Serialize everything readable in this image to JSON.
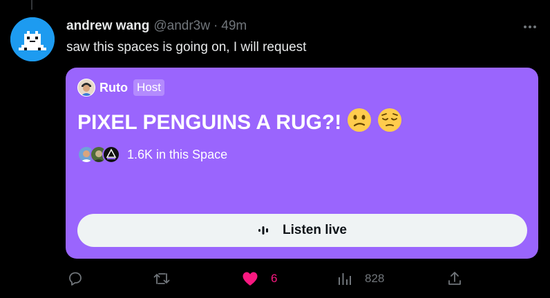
{
  "tweet": {
    "author_name": "andrew wang",
    "handle": "@andr3w",
    "separator": "·",
    "time": "49m",
    "text": "saw this spaces is going on, I will request"
  },
  "space": {
    "host_name": "Ruto",
    "host_badge": "Host",
    "title": "PIXEL PENGUINS A RUG?!",
    "title_emojis": [
      "confused-face",
      "pensive-face"
    ],
    "listeners_text": "1.6K in this Space",
    "button_label": "Listen live",
    "card_color": "#9a65fd"
  },
  "actions": {
    "reply_count": "",
    "retweet_count": "",
    "like_count": "6",
    "views_count": "828"
  },
  "colors": {
    "background": "#000000",
    "text": "#e7e9ea",
    "muted": "#71767b",
    "like": "#f91880",
    "avatar_bg": "#1d9bf0"
  }
}
